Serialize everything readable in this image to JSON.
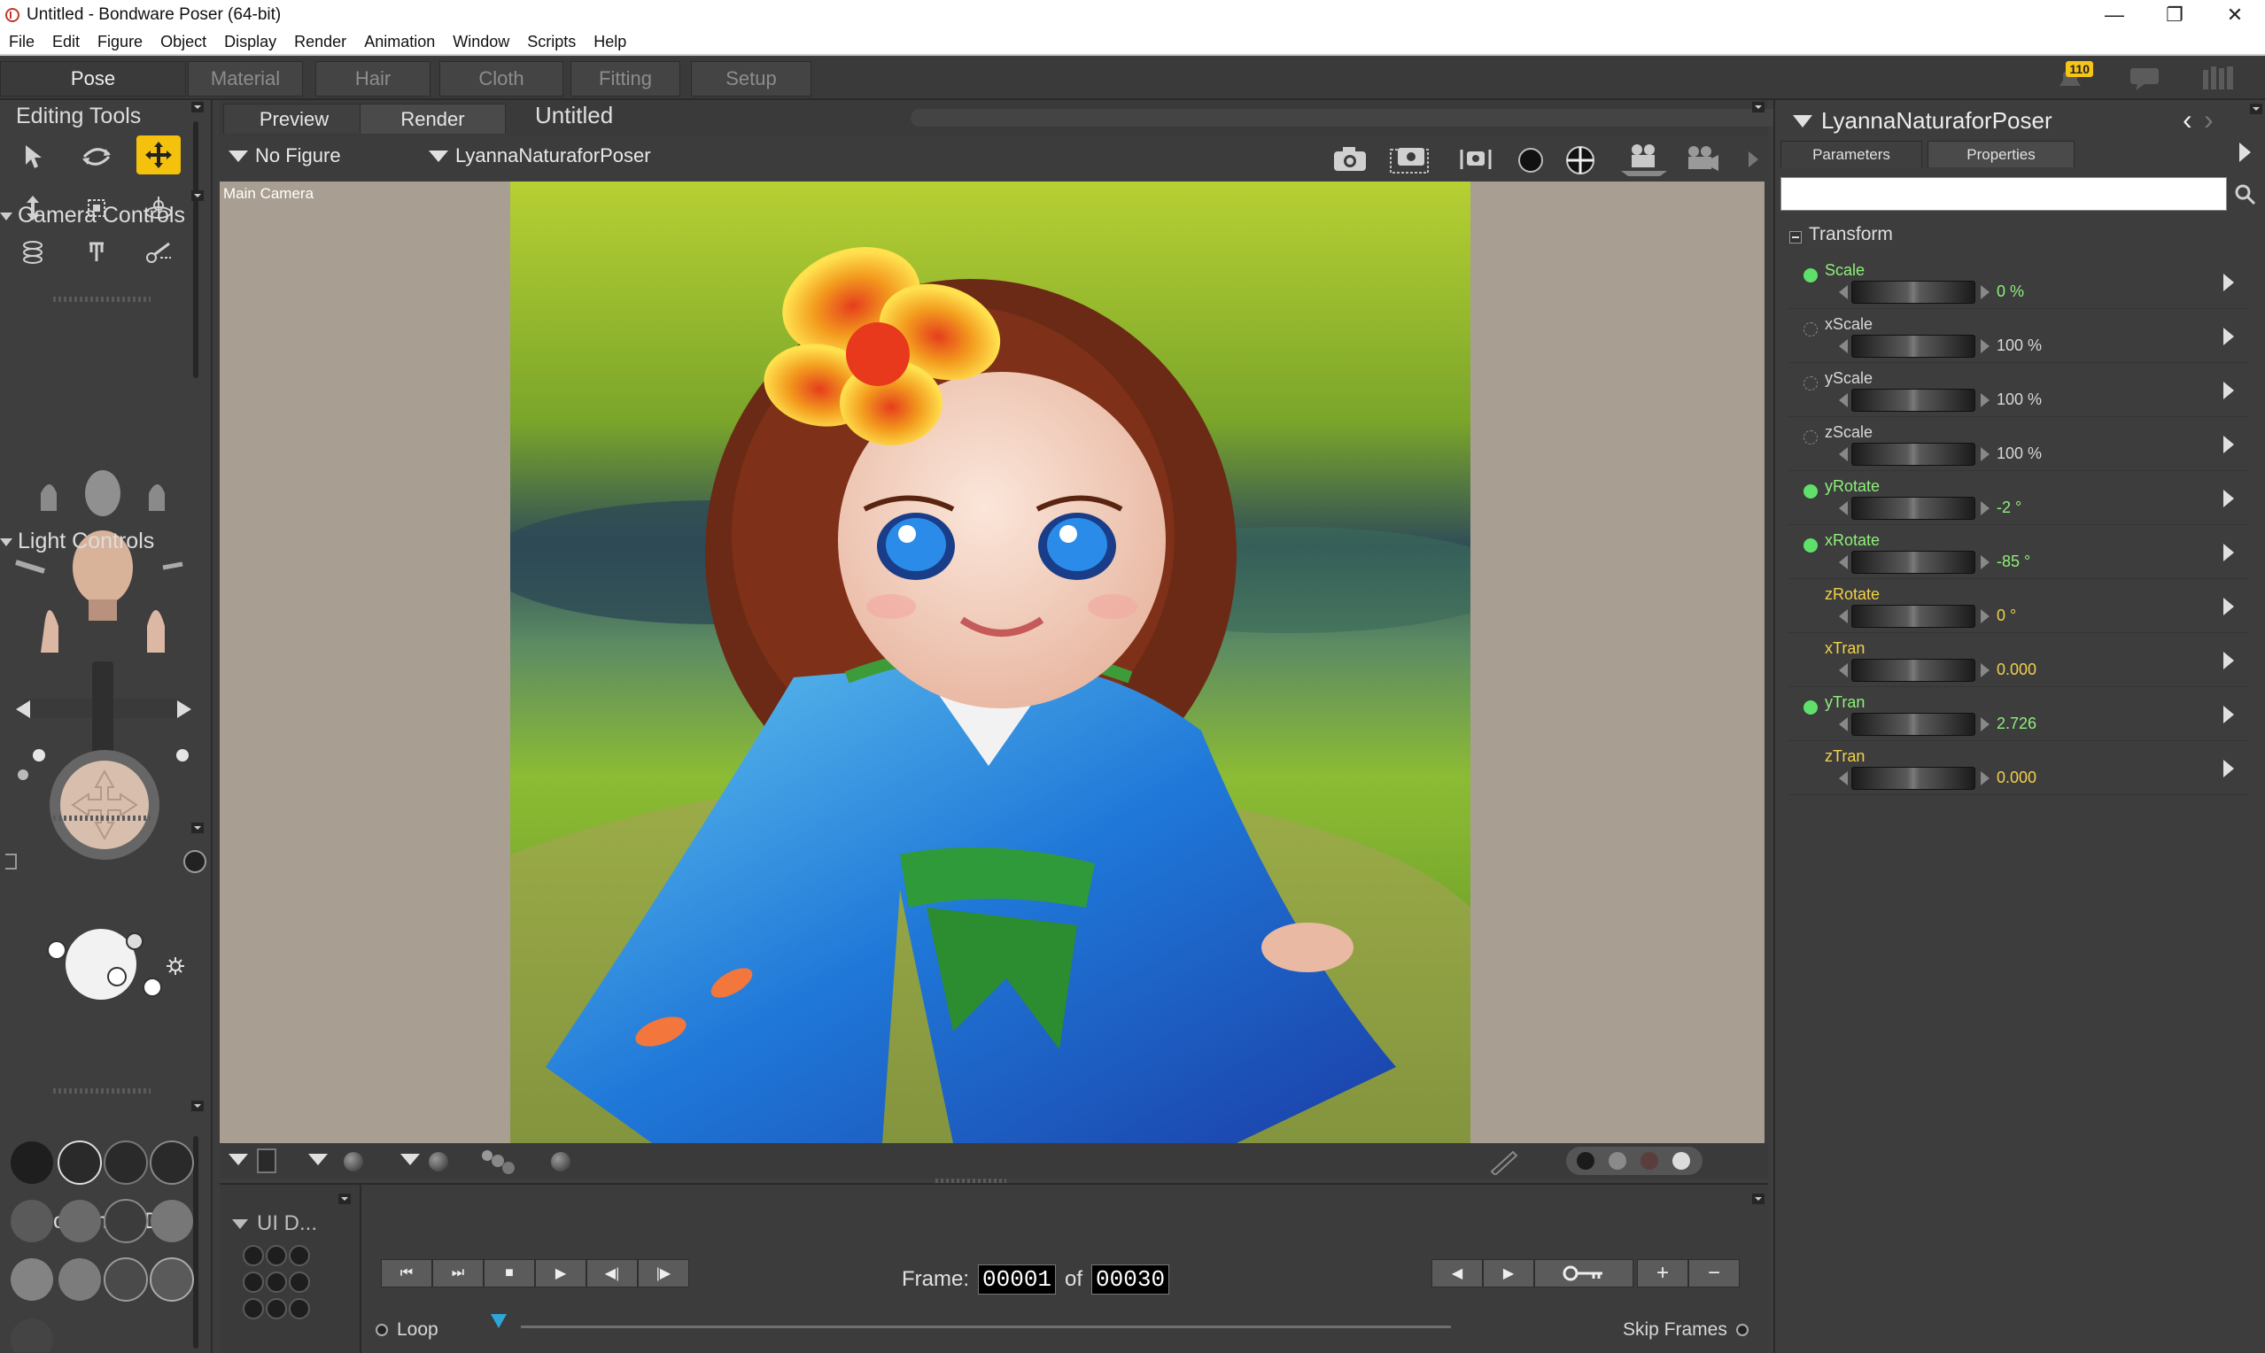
{
  "window": {
    "title": "Untitled - Bondware Poser (64-bit)",
    "controls": [
      "—",
      "❐",
      "✕"
    ]
  },
  "menu": [
    "File",
    "Edit",
    "Figure",
    "Object",
    "Display",
    "Render",
    "Animation",
    "Window",
    "Scripts",
    "Help"
  ],
  "rooms": [
    "Pose",
    "Material",
    "Hair",
    "Cloth",
    "Fitting",
    "Setup"
  ],
  "active_room": "Pose",
  "notifications": {
    "count": "110"
  },
  "left": {
    "editing_tools_title": "Editing Tools",
    "camera_controls_title": "Camera Controls",
    "light_controls_title": "Light Controls",
    "document_display_title": "Document Di...",
    "ui_dots_title": "UI D..."
  },
  "viewport": {
    "tabs": [
      "Preview",
      "Render"
    ],
    "active_tab": "Preview",
    "document_title": "Untitled",
    "figure_dropdown": "No Figure",
    "actor_dropdown": "LyannaNaturaforPoser",
    "camera_label": "Main Camera"
  },
  "animation": {
    "frame_label": "Frame:",
    "current_frame": "00001",
    "of_label": "of",
    "total_frames": "00030",
    "loop_label": "Loop",
    "skip_frames_label": "Skip Frames",
    "playback_buttons": [
      "⏮",
      "⏭",
      "■",
      "▶",
      "◀|",
      "|▶"
    ],
    "key_buttons": [
      "◀",
      "▶",
      "⊸",
      "+",
      "−"
    ]
  },
  "parameters": {
    "actor_name": "LyannaNaturaforPoser",
    "tabs": [
      "Parameters",
      "Properties"
    ],
    "search_value": "",
    "group_title": "Transform",
    "items": [
      {
        "name": "Scale",
        "value": "0 %",
        "keyed": true,
        "changed": true
      },
      {
        "name": "xScale",
        "value": "100 %",
        "keyed": false,
        "changed": false
      },
      {
        "name": "yScale",
        "value": "100 %",
        "keyed": false,
        "changed": false
      },
      {
        "name": "zScale",
        "value": "100 %",
        "keyed": false,
        "changed": false
      },
      {
        "name": "yRotate",
        "value": "-2 °",
        "keyed": true,
        "changed": true
      },
      {
        "name": "xRotate",
        "value": "-85 °",
        "keyed": true,
        "changed": true
      },
      {
        "name": "zRotate",
        "value": "0 °",
        "keyed": false,
        "changed": true
      },
      {
        "name": "xTran",
        "value": "0.000",
        "keyed": false,
        "changed": true
      },
      {
        "name": "yTran",
        "value": "2.726",
        "keyed": true,
        "changed": true
      },
      {
        "name": "zTran",
        "value": "0.000",
        "keyed": false,
        "changed": true
      }
    ],
    "colors": {
      "changed_text": "#f2d14a",
      "changed_name_keyed": "#8ef07a",
      "default_text": "#d8d8d8",
      "key_dot": "#5fe06a"
    }
  }
}
